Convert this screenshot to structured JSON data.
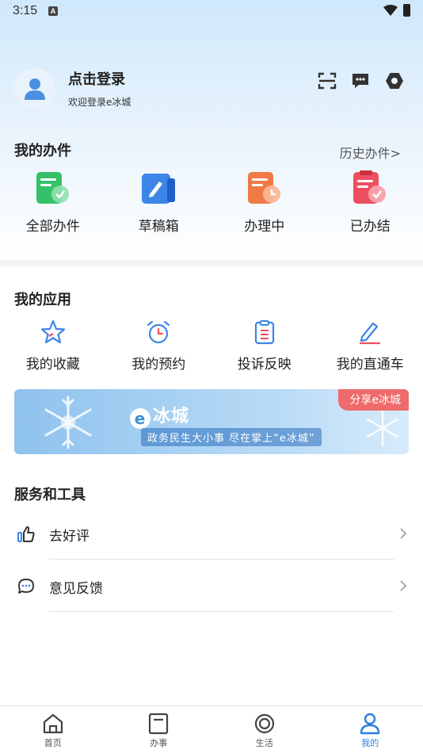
{
  "status_bar": {
    "time": "3:15",
    "indicator": "A",
    "icons": [
      "wifi-icon",
      "battery-icon"
    ]
  },
  "profile": {
    "title": "点击登录",
    "subtitle": "欢迎登录e冰城"
  },
  "header_actions": [
    {
      "name": "scan-icon"
    },
    {
      "name": "message-icon"
    },
    {
      "name": "settings-icon"
    }
  ],
  "my_tasks": {
    "title": "我的办件",
    "history_link": "历史办件>",
    "items": [
      {
        "label": "全部办件",
        "icon": "all-tasks-icon",
        "color": "#36c06a"
      },
      {
        "label": "草稿箱",
        "icon": "drafts-icon",
        "color": "#3d86e8"
      },
      {
        "label": "办理中",
        "icon": "in-progress-icon",
        "color": "#f07a45"
      },
      {
        "label": "已办结",
        "icon": "completed-icon",
        "color": "#ee4f60"
      }
    ]
  },
  "my_apps": {
    "title": "我的应用",
    "items": [
      {
        "label": "我的收藏",
        "icon": "star-icon"
      },
      {
        "label": "我的预约",
        "icon": "alarm-clock-icon"
      },
      {
        "label": "投诉反映",
        "icon": "clipboard-icon"
      },
      {
        "label": "我的直通车",
        "icon": "edit-pen-icon"
      }
    ]
  },
  "banner": {
    "share_label": "分享e冰城",
    "brand_e": "e",
    "brand_text": "冰城",
    "slogan": "政务民生大小事 尽在掌上“e冰城”"
  },
  "services": {
    "title": "服务和工具",
    "items": [
      {
        "label": "去好评",
        "icon": "thumbs-up-icon"
      },
      {
        "label": "意见反馈",
        "icon": "chat-bubble-icon"
      }
    ]
  },
  "bottom_nav": {
    "items": [
      {
        "label": "首页",
        "icon": "home-icon",
        "active": false
      },
      {
        "label": "办事",
        "icon": "document-icon",
        "active": false
      },
      {
        "label": "生活",
        "icon": "life-ring-icon",
        "active": false
      },
      {
        "label": "我的",
        "icon": "user-icon",
        "active": true
      }
    ]
  },
  "colors": {
    "accent": "#2f7fe0",
    "apps_icon": "#3d86e8",
    "share_badge": "#ef6b6b"
  }
}
